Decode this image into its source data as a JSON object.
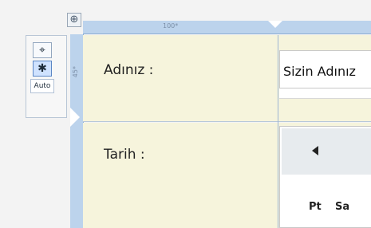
{
  "toolbar": {
    "move_icon_glyph": "⊕",
    "crosshair_glyph": "⌖",
    "asterisk_glyph": "✱",
    "auto_label": "Auto"
  },
  "rulers": {
    "top_label": "100*",
    "left_label": "45*"
  },
  "form": {
    "name_label": "Adınız :",
    "name_value": "Sizin Adınız",
    "date_label": "Tarih :"
  },
  "calendar": {
    "weekdays": [
      "Pt",
      "Sa"
    ]
  },
  "colors": {
    "label_bg": "#f6f4dc",
    "ruler_bg": "#bcd3ec"
  }
}
